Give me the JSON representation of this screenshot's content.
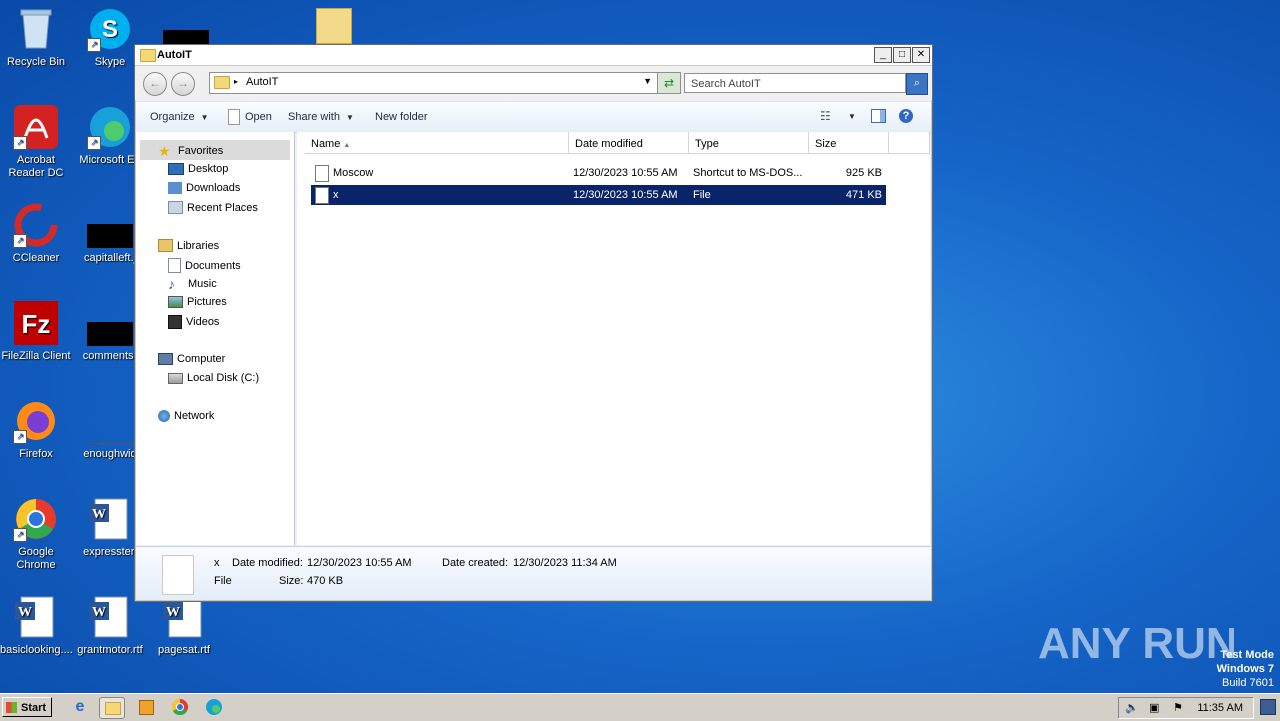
{
  "desktop": {
    "icons": [
      {
        "label": "Recycle Bin"
      },
      {
        "label": "Skype"
      },
      {
        "label": "Acrobat Reader DC"
      },
      {
        "label": "Microsoft Ed"
      },
      {
        "label": "CCleaner"
      },
      {
        "label": "capitalleft.j"
      },
      {
        "label": "FileZilla Client"
      },
      {
        "label": "commentsr"
      },
      {
        "label": "Firefox"
      },
      {
        "label": "enoughwid"
      },
      {
        "label": "Google Chrome"
      },
      {
        "label": "expresster."
      },
      {
        "label": "basiclooking...."
      },
      {
        "label": "grantmotor.rtf"
      },
      {
        "label": "pagesat.rtf"
      }
    ]
  },
  "window": {
    "title": "AutoIT",
    "address_path": "AutoIT",
    "search_placeholder": "Search AutoIT",
    "toolbar": {
      "organize": "Organize",
      "open": "Open",
      "share_with": "Share with",
      "new_folder": "New folder"
    },
    "nav": {
      "favorites": "Favorites",
      "desktop": "Desktop",
      "downloads": "Downloads",
      "recent_places": "Recent Places",
      "libraries": "Libraries",
      "documents": "Documents",
      "music": "Music",
      "pictures": "Pictures",
      "videos": "Videos",
      "computer": "Computer",
      "local_disk": "Local Disk (C:)",
      "network": "Network"
    },
    "columns": {
      "name": "Name",
      "date_modified": "Date modified",
      "type": "Type",
      "size": "Size"
    },
    "files": [
      {
        "name": "Moscow",
        "date": "12/30/2023 10:55 AM",
        "type": "Shortcut to MS-DOS...",
        "size": "925 KB",
        "selected": false
      },
      {
        "name": "x",
        "date": "12/30/2023 10:55 AM",
        "type": "File",
        "size": "471 KB",
        "selected": true
      }
    ],
    "details": {
      "name": "x",
      "type": "File",
      "date_modified_label": "Date modified:",
      "date_modified": "12/30/2023 10:55 AM",
      "date_created_label": "Date created:",
      "date_created": "12/30/2023 11:34 AM",
      "size_label": "Size:",
      "size": "470 KB"
    }
  },
  "taskbar": {
    "start": "Start",
    "clock": "11:35 AM"
  },
  "watermark": {
    "brand": "ANY RUN",
    "line1": "Test Mode",
    "line2": "Windows 7",
    "line3": "Build 7601"
  }
}
